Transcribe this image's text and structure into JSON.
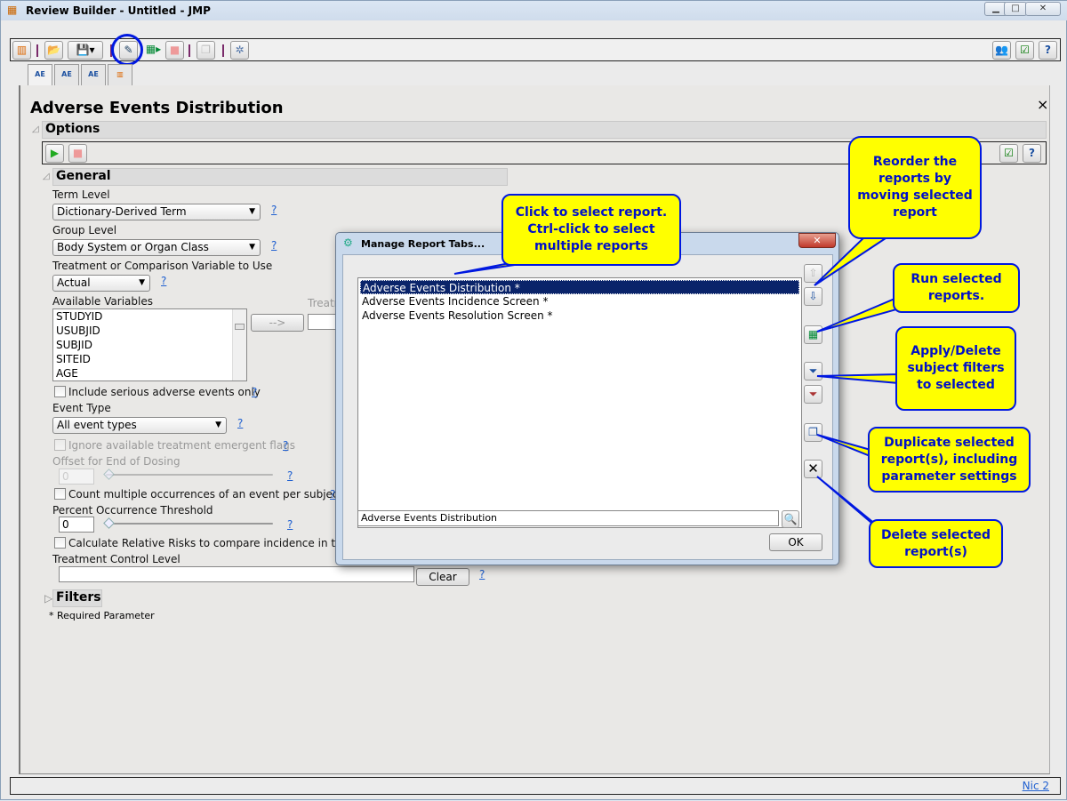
{
  "window": {
    "title": "Review Builder - Untitled - JMP",
    "min": "▁",
    "max": "□",
    "close": "✕"
  },
  "toolbar": {
    "icons": [
      "new-report-icon",
      "open-folder-icon",
      "save-icon",
      "edit-report-icon",
      "run-reports-icon",
      "stop-icon",
      "duplicate-icon",
      "settings-icon"
    ],
    "right_icons": [
      "users-icon",
      "check-list-icon",
      "help-icon"
    ],
    "help": "?"
  },
  "tabs": [
    "AE",
    "AE",
    "AE",
    ""
  ],
  "main": {
    "title": "Adverse Events Distribution",
    "close": "×",
    "options": {
      "label": "Options",
      "help": "?"
    },
    "general": {
      "label": "General",
      "term_level_label": "Term Level",
      "term_level": "Dictionary-Derived Term",
      "group_level_label": "Group Level",
      "group_level": "Body System or Organ Class",
      "treatment_label": "Treatment or Comparison Variable to Use",
      "treatment": "Actual",
      "available_label": "Available Variables",
      "variables": [
        "STUDYID",
        "USUBJID",
        "SUBJID",
        "SITEID",
        "AGE"
      ],
      "move_button": "-->",
      "treatment_col_label": "Treatm",
      "serious_label": "Include serious adverse events only",
      "event_type_label": "Event Type",
      "event_type": "All event types",
      "ignore_label": "Ignore available treatment emergent flags",
      "offset_label": "Offset for End of Dosing",
      "offset_value": "0",
      "count_label": "Count multiple occurrences of an event per subject",
      "threshold_label": "Percent Occurrence Threshold",
      "threshold_value": "0",
      "relrisk_label": "Calculate Relative Risks to compare incidence in treatm",
      "control_label": "Treatment Control Level",
      "control_value": "",
      "clear": "Clear",
      "help": "?"
    },
    "filters": {
      "label": "Filters"
    },
    "required_note": "* Required Parameter"
  },
  "dialog": {
    "title": "Manage Report Tabs...",
    "close": "✕",
    "reports": [
      "Adverse Events Distribution *",
      "Adverse Events Incidence Screen *",
      "Adverse Events Resolution Screen *"
    ],
    "selected_index": 0,
    "name_value": "Adverse Events Distribution",
    "ok": "OK"
  },
  "callouts": {
    "select": "Click to select report. Ctrl-click to select multiple reports",
    "reorder": "Reorder the reports by moving selected report",
    "run": "Run selected reports.",
    "filters": "Apply/Delete subject filters to selected",
    "duplicate": "Duplicate selected report(s), including parameter settings",
    "delete": "Delete selected report(s)"
  },
  "callout_colors": {
    "fill": "#ffff00",
    "border": "#0018e0",
    "text": "#0010c8"
  },
  "status": {
    "link": "Nic 2"
  }
}
